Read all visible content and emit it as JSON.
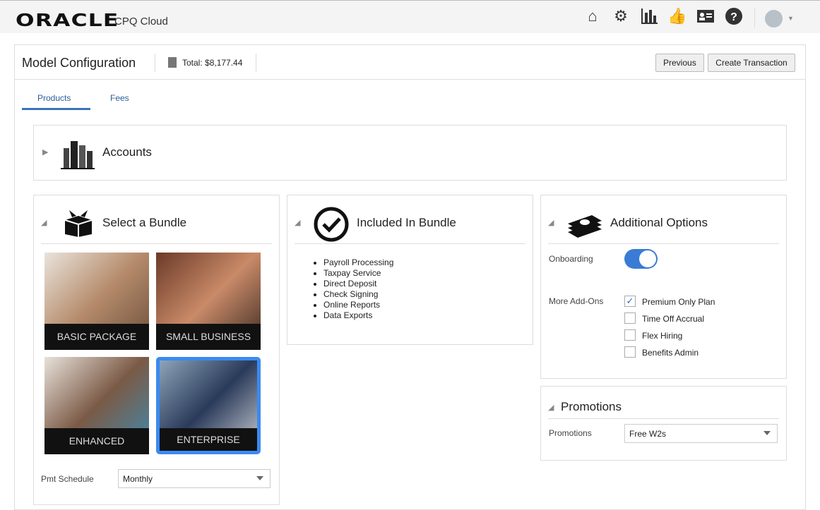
{
  "header": {
    "logo": "ORACLE",
    "product": "CPQ Cloud",
    "icons": [
      "home-icon",
      "gear-icon",
      "reports-icon",
      "approvals-icon",
      "contact-card-icon",
      "help-icon"
    ]
  },
  "page": {
    "title": "Model Configuration",
    "total": "Total: $8,177.44",
    "previous": "Previous",
    "create": "Create Transaction"
  },
  "tabs": [
    {
      "label": "Products",
      "active": true
    },
    {
      "label": "Fees"
    }
  ],
  "accounts": {
    "title": "Accounts"
  },
  "bundle": {
    "title": "Select a Bundle",
    "tiles": [
      {
        "label": "BASIC PACKAGE"
      },
      {
        "label": "SMALL BUSINESS"
      },
      {
        "label": "ENHANCED"
      },
      {
        "label": "ENTERPRISE",
        "selected": true
      }
    ],
    "pmt_label": "Pmt Schedule",
    "pmt_value": "Monthly"
  },
  "included": {
    "title": "Included In Bundle",
    "items": [
      "Payroll Processing",
      "Taxpay Service",
      "Direct Deposit",
      "Check Signing",
      "Online Reports",
      "Data Exports"
    ]
  },
  "options": {
    "title": "Additional Options",
    "onboarding_label": "Onboarding",
    "onboarding_on": true,
    "addons_label": "More Add-Ons",
    "addons": [
      {
        "label": "Premium Only Plan",
        "checked": true
      },
      {
        "label": "Time Off Accrual",
        "checked": false
      },
      {
        "label": "Flex Hiring",
        "checked": false
      },
      {
        "label": "Benefits Admin",
        "checked": false
      }
    ]
  },
  "promotions": {
    "title": "Promotions",
    "label": "Promotions",
    "value": "Free W2s"
  }
}
